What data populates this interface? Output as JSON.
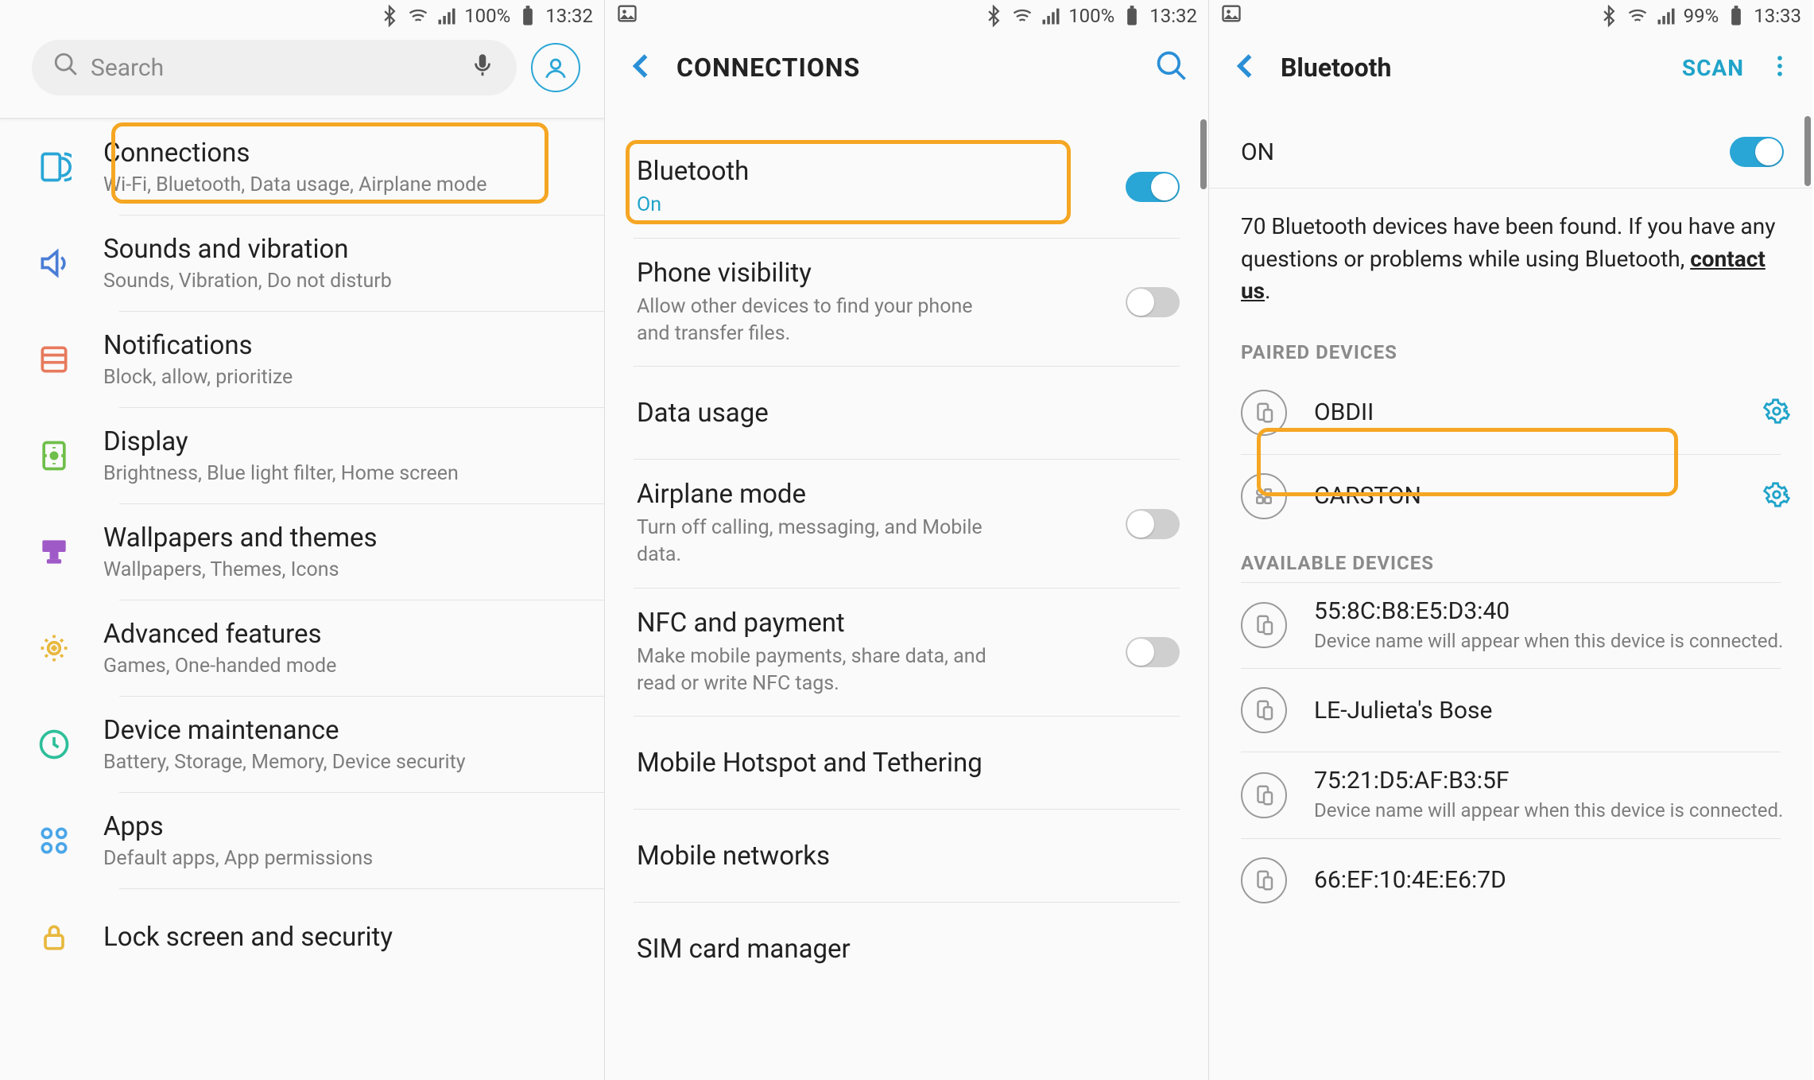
{
  "status": {
    "s1": {
      "battery_pct": "100%",
      "time": "13:32",
      "has_left_img": false
    },
    "s2": {
      "battery_pct": "100%",
      "time": "13:32",
      "has_left_img": true
    },
    "s3": {
      "battery_pct": "99%",
      "time": "13:33",
      "has_left_img": true
    }
  },
  "screen1": {
    "search_placeholder": "Search",
    "items": [
      {
        "title": "Connections",
        "sub": "Wi-Fi, Bluetooth, Data usage, Airplane mode"
      },
      {
        "title": "Sounds and vibration",
        "sub": "Sounds, Vibration, Do not disturb"
      },
      {
        "title": "Notifications",
        "sub": "Block, allow, prioritize"
      },
      {
        "title": "Display",
        "sub": "Brightness, Blue light filter, Home screen"
      },
      {
        "title": "Wallpapers and themes",
        "sub": "Wallpapers, Themes, Icons"
      },
      {
        "title": "Advanced features",
        "sub": "Games, One-handed mode"
      },
      {
        "title": "Device maintenance",
        "sub": "Battery, Storage, Memory, Device security"
      },
      {
        "title": "Apps",
        "sub": "Default apps, App permissions"
      },
      {
        "title": "Lock screen and security",
        "sub": ""
      }
    ]
  },
  "screen2": {
    "title": "CONNECTIONS",
    "items": [
      {
        "title": "Bluetooth",
        "sub": "On",
        "toggle": "on"
      },
      {
        "title": "Phone visibility",
        "sub": "Allow other devices to find your phone and transfer files.",
        "toggle": "off"
      },
      {
        "title": "Data usage",
        "sub": "",
        "toggle": ""
      },
      {
        "title": "Airplane mode",
        "sub": "Turn off calling, messaging, and Mobile data.",
        "toggle": "off"
      },
      {
        "title": "NFC and payment",
        "sub": "Make mobile payments, share data, and read or write NFC tags.",
        "toggle": "off"
      },
      {
        "title": "Mobile Hotspot and Tethering",
        "sub": "",
        "toggle": ""
      },
      {
        "title": "Mobile networks",
        "sub": "",
        "toggle": ""
      },
      {
        "title": "SIM card manager",
        "sub": "",
        "toggle": ""
      }
    ]
  },
  "screen3": {
    "title": "Bluetooth",
    "scan_label": "SCAN",
    "on_label": "ON",
    "info_pre": "70 Bluetooth devices have been found. If you have any questions or problems while using Bluetooth, ",
    "info_link": "contact us",
    "info_post": ".",
    "paired_header": "PAIRED DEVICES",
    "available_header": "AVAILABLE DEVICES",
    "paired": [
      {
        "name": "OBDII"
      },
      {
        "name": "CARSTON"
      }
    ],
    "available": [
      {
        "name": "55:8C:B8:E5:D3:40",
        "sub": "Device name will appear when this device is connected."
      },
      {
        "name": "LE-Julieta's Bose",
        "sub": ""
      },
      {
        "name": "75:21:D5:AF:B3:5F",
        "sub": "Device name will appear when this device is connected."
      },
      {
        "name": "66:EF:10:4E:E6:7D",
        "sub": ""
      }
    ]
  },
  "colors": {
    "accent": "#20a3c9",
    "highlight": "#f5a623"
  }
}
